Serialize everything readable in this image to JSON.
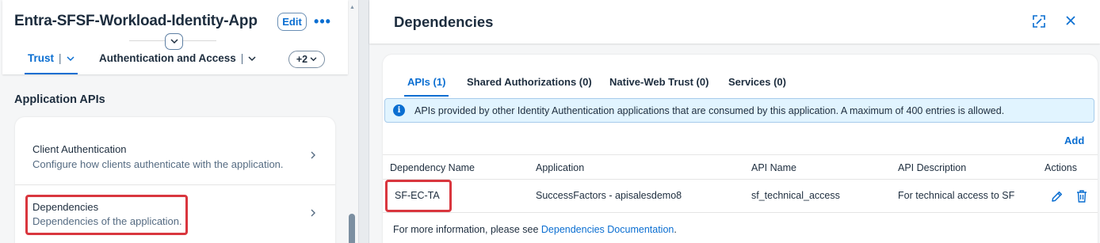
{
  "left": {
    "app_title": "Entra-SFSF-Workload-Identity-App",
    "edit_label": "Edit",
    "more_label": "•••",
    "tabs": [
      {
        "label": "Trust"
      },
      {
        "label": "Authentication and Access"
      }
    ],
    "more_tabs_label": "+2",
    "section_title": "Application APIs",
    "items": [
      {
        "title": "Client Authentication",
        "description": "Configure how clients authenticate with the application."
      },
      {
        "title": "Dependencies",
        "description": "Dependencies of the application."
      }
    ]
  },
  "dialog": {
    "title": "Dependencies",
    "tabs": [
      {
        "label": "APIs (1)"
      },
      {
        "label": "Shared Authorizations (0)"
      },
      {
        "label": "Native-Web Trust (0)"
      },
      {
        "label": "Services (0)"
      }
    ],
    "info_text": "APIs provided by other Identity Authentication applications that are consumed by this application. A maximum of 400 entries is allowed.",
    "add_label": "Add",
    "table": {
      "headers": [
        "Dependency Name",
        "Application",
        "API Name",
        "API Description",
        "Actions"
      ],
      "rows": [
        {
          "dependency_name": "SF-EC-TA",
          "application": "SuccessFactors - apisalesdemo8",
          "api_name": "sf_technical_access",
          "api_description": "For technical access to SF"
        }
      ]
    },
    "footer_prefix": "For more information, please see ",
    "footer_link": "Dependencies Documentation",
    "footer_suffix": "."
  },
  "icons": {
    "collapse": "chevron-up-down-icon",
    "expand": "fullscreen-icon",
    "close": "close-icon",
    "info": "information-icon",
    "edit": "pencil-icon",
    "delete": "trash-icon"
  },
  "colors": {
    "accent": "#0a6ed1",
    "highlight": "#d9363e",
    "info_bg": "#e1f4ff"
  }
}
